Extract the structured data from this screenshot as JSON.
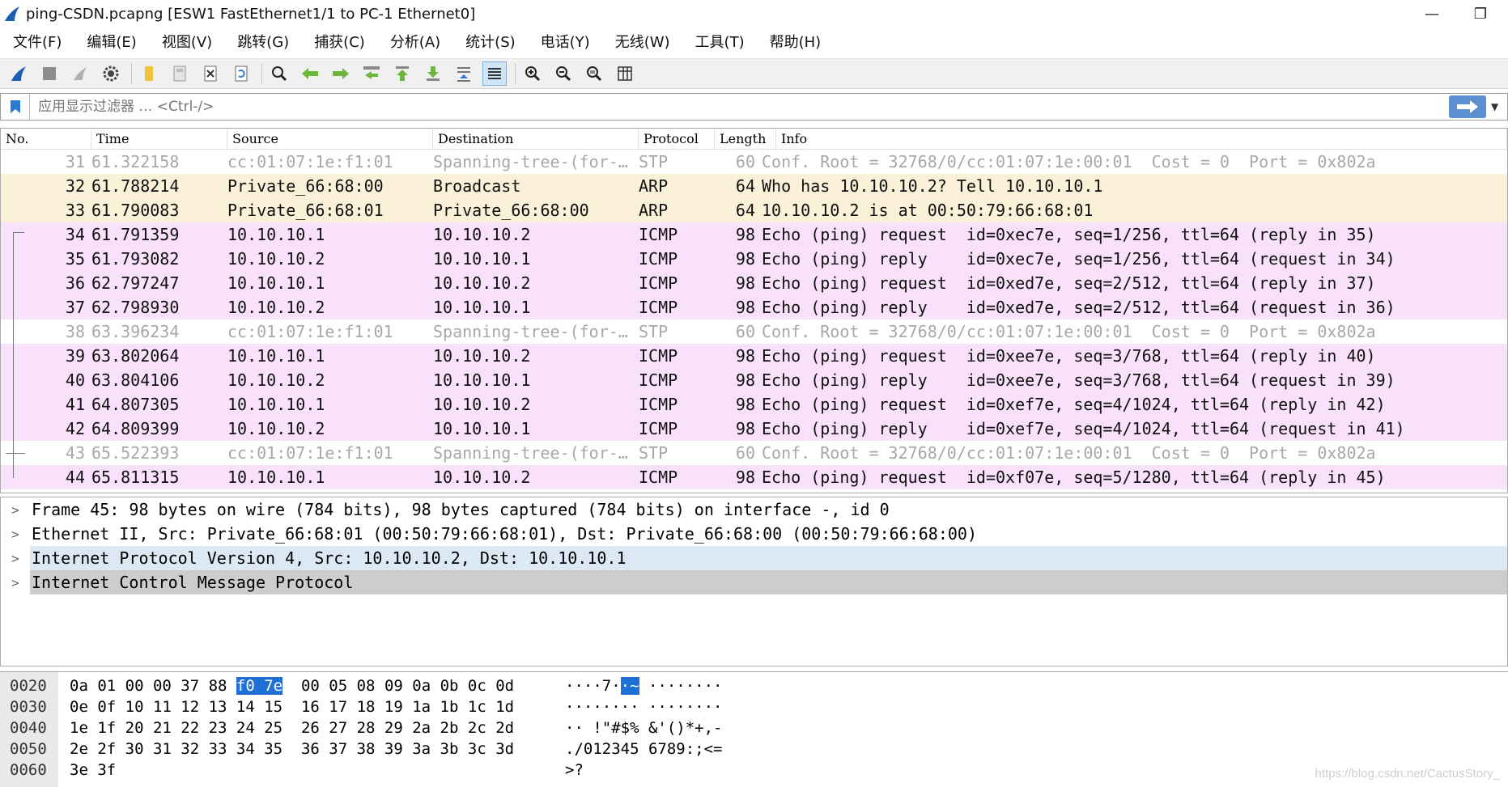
{
  "window": {
    "title": "ping-CSDN.pcapng [ESW1 FastEthernet1/1 to PC-1 Ethernet0]",
    "minimize_glyph": "—",
    "restore_glyph": "❐"
  },
  "menu": [
    "文件(F)",
    "编辑(E)",
    "视图(V)",
    "跳转(G)",
    "捕获(C)",
    "分析(A)",
    "统计(S)",
    "电话(Y)",
    "无线(W)",
    "工具(T)",
    "帮助(H)"
  ],
  "filter": {
    "placeholder": "应用显示过滤器 … <Ctrl-/>"
  },
  "packet_list": {
    "columns": [
      "No.",
      "Time",
      "Source",
      "Destination",
      "Protocol",
      "Length",
      "Info"
    ],
    "rows": [
      {
        "no": "31",
        "time": "61.322158",
        "src": "cc:01:07:1e:f1:01",
        "dst": "Spanning-tree-(for-…",
        "proto": "STP",
        "len": "60",
        "info": "Conf. Root = 32768/0/cc:01:07:1e:00:01  Cost = 0  Port = 0x802a",
        "kind": "stp"
      },
      {
        "no": "32",
        "time": "61.788214",
        "src": "Private_66:68:00",
        "dst": "Broadcast",
        "proto": "ARP",
        "len": "64",
        "info": "Who has 10.10.10.2? Tell 10.10.10.1",
        "kind": "arp"
      },
      {
        "no": "33",
        "time": "61.790083",
        "src": "Private_66:68:01",
        "dst": "Private_66:68:00",
        "proto": "ARP",
        "len": "64",
        "info": "10.10.10.2 is at 00:50:79:66:68:01",
        "kind": "arp"
      },
      {
        "no": "34",
        "time": "61.791359",
        "src": "10.10.10.1",
        "dst": "10.10.10.2",
        "proto": "ICMP",
        "len": "98",
        "info": "Echo (ping) request  id=0xec7e, seq=1/256, ttl=64 (reply in 35)",
        "kind": "icmp"
      },
      {
        "no": "35",
        "time": "61.793082",
        "src": "10.10.10.2",
        "dst": "10.10.10.1",
        "proto": "ICMP",
        "len": "98",
        "info": "Echo (ping) reply    id=0xec7e, seq=1/256, ttl=64 (request in 34)",
        "kind": "icmp"
      },
      {
        "no": "36",
        "time": "62.797247",
        "src": "10.10.10.1",
        "dst": "10.10.10.2",
        "proto": "ICMP",
        "len": "98",
        "info": "Echo (ping) request  id=0xed7e, seq=2/512, ttl=64 (reply in 37)",
        "kind": "icmp"
      },
      {
        "no": "37",
        "time": "62.798930",
        "src": "10.10.10.2",
        "dst": "10.10.10.1",
        "proto": "ICMP",
        "len": "98",
        "info": "Echo (ping) reply    id=0xed7e, seq=2/512, ttl=64 (request in 36)",
        "kind": "icmp"
      },
      {
        "no": "38",
        "time": "63.396234",
        "src": "cc:01:07:1e:f1:01",
        "dst": "Spanning-tree-(for-…",
        "proto": "STP",
        "len": "60",
        "info": "Conf. Root = 32768/0/cc:01:07:1e:00:01  Cost = 0  Port = 0x802a",
        "kind": "stp"
      },
      {
        "no": "39",
        "time": "63.802064",
        "src": "10.10.10.1",
        "dst": "10.10.10.2",
        "proto": "ICMP",
        "len": "98",
        "info": "Echo (ping) request  id=0xee7e, seq=3/768, ttl=64 (reply in 40)",
        "kind": "icmp"
      },
      {
        "no": "40",
        "time": "63.804106",
        "src": "10.10.10.2",
        "dst": "10.10.10.1",
        "proto": "ICMP",
        "len": "98",
        "info": "Echo (ping) reply    id=0xee7e, seq=3/768, ttl=64 (request in 39)",
        "kind": "icmp"
      },
      {
        "no": "41",
        "time": "64.807305",
        "src": "10.10.10.1",
        "dst": "10.10.10.2",
        "proto": "ICMP",
        "len": "98",
        "info": "Echo (ping) request  id=0xef7e, seq=4/1024, ttl=64 (reply in 42)",
        "kind": "icmp"
      },
      {
        "no": "42",
        "time": "64.809399",
        "src": "10.10.10.2",
        "dst": "10.10.10.1",
        "proto": "ICMP",
        "len": "98",
        "info": "Echo (ping) reply    id=0xef7e, seq=4/1024, ttl=64 (request in 41)",
        "kind": "icmp"
      },
      {
        "no": "43",
        "time": "65.522393",
        "src": "cc:01:07:1e:f1:01",
        "dst": "Spanning-tree-(for-…",
        "proto": "STP",
        "len": "60",
        "info": "Conf. Root = 32768/0/cc:01:07:1e:00:01  Cost = 0  Port = 0x802a",
        "kind": "stp"
      },
      {
        "no": "44",
        "time": "65.811315",
        "src": "10.10.10.1",
        "dst": "10.10.10.2",
        "proto": "ICMP",
        "len": "98",
        "info": "Echo (ping) request  id=0xf07e, seq=5/1280, ttl=64 (reply in 45)",
        "kind": "icmp"
      }
    ]
  },
  "details": [
    {
      "text": "Frame 45: 98 bytes on wire (784 bits), 98 bytes captured (784 bits) on interface -, id 0",
      "style": "plain"
    },
    {
      "text": "Ethernet II, Src: Private_66:68:01 (00:50:79:66:68:01), Dst: Private_66:68:00 (00:50:79:66:68:00)",
      "style": "plain"
    },
    {
      "text": "Internet Protocol Version 4, Src: 10.10.10.2, Dst: 10.10.10.1",
      "style": "ip"
    },
    {
      "text": "Internet Control Message Protocol",
      "style": "icmp"
    }
  ],
  "bytes": {
    "lines": [
      {
        "offset": "0020",
        "hex_pre": "0a 01 00 00 37 88 ",
        "hex_hl": "f0 7e",
        "hex_post": "  00 05 08 09 0a 0b 0c 0d",
        "ascii_pre": "····7·",
        "ascii_hl": "·~",
        "ascii_post": " ········"
      },
      {
        "offset": "0030",
        "hex_pre": "0e 0f 10 11 12 13 14 15  16 17 18 19 1a 1b 1c 1d",
        "hex_hl": "",
        "hex_post": "",
        "ascii_pre": "········ ········",
        "ascii_hl": "",
        "ascii_post": ""
      },
      {
        "offset": "0040",
        "hex_pre": "1e 1f 20 21 22 23 24 25  26 27 28 29 2a 2b 2c 2d",
        "hex_hl": "",
        "hex_post": "",
        "ascii_pre": "·· !\"#$% &'()*+,-",
        "ascii_hl": "",
        "ascii_post": ""
      },
      {
        "offset": "0050",
        "hex_pre": "2e 2f 30 31 32 33 34 35  36 37 38 39 3a 3b 3c 3d",
        "hex_hl": "",
        "hex_post": "",
        "ascii_pre": "./012345 6789:;<=",
        "ascii_hl": "",
        "ascii_post": ""
      },
      {
        "offset": "0060",
        "hex_pre": "3e 3f",
        "hex_hl": "",
        "hex_post": "",
        "ascii_pre": ">?",
        "ascii_hl": "",
        "ascii_post": ""
      }
    ]
  },
  "watermark": "https://blog.csdn.net/CactusStory_",
  "colors": {
    "stp_row": "#ffffff",
    "arp_row": "#fbf0d8",
    "icmp_row": "#f9e1fb",
    "selection": "#1e6fd6"
  }
}
